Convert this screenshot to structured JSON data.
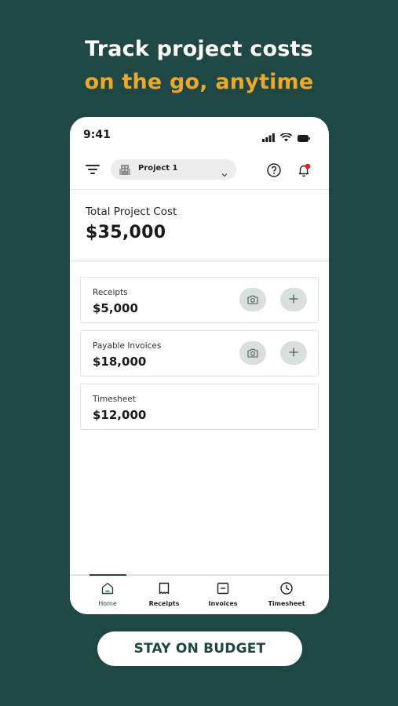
{
  "headline": {
    "line1": "Track project costs",
    "line2": "on the go, anytime"
  },
  "status_bar": {
    "time": "9:41",
    "icons": [
      "signal-icon",
      "wifi-icon",
      "battery-icon"
    ]
  },
  "topbar": {
    "project_name": "Project 1",
    "icons": [
      "filter-icon",
      "building-icon",
      "chevron-down-icon",
      "help-icon",
      "bell-icon"
    ],
    "notification_dot_color": "#e02424"
  },
  "summary": {
    "label": "Total Project Cost",
    "value": "$35,000"
  },
  "cards": [
    {
      "label": "Receipts",
      "value": "$5,000",
      "actions": [
        "camera-icon",
        "plus-icon"
      ]
    },
    {
      "label": "Payable Invoices",
      "value": "$18,000",
      "actions": [
        "camera-icon",
        "plus-icon"
      ]
    },
    {
      "label": "Timesheet",
      "value": "$12,000",
      "actions": []
    }
  ],
  "tabs": [
    {
      "label": "Home",
      "icon": "home-icon",
      "active": true
    },
    {
      "label": "Receipts",
      "icon": "receipt-icon",
      "active": false
    },
    {
      "label": "Invoices",
      "icon": "invoice-icon",
      "active": false
    },
    {
      "label": "Timesheet",
      "icon": "clock-icon",
      "active": false
    }
  ],
  "cta": {
    "label": "STAY ON BUDGET"
  },
  "colors": {
    "background": "#1f4744",
    "accent_orange": "#eba82a",
    "action_circle": "#d8dfdd"
  }
}
